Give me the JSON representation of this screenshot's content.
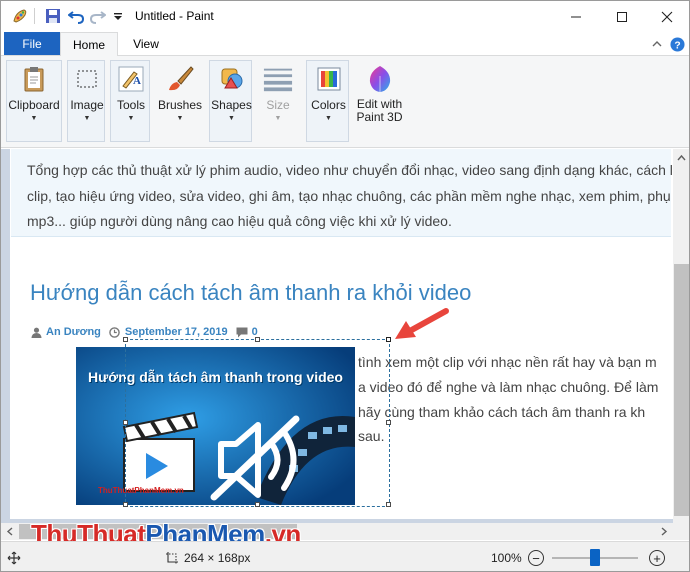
{
  "window": {
    "title": "Untitled - Paint"
  },
  "quick_access": [
    "paint-app-icon",
    "save-icon",
    "undo-icon",
    "redo-icon",
    "customize-dropdown-icon"
  ],
  "window_controls": [
    "minimize-icon",
    "maximize-icon",
    "close-icon"
  ],
  "tabs": [
    {
      "label": "File",
      "active": false
    },
    {
      "label": "Home",
      "active": true
    },
    {
      "label": "View",
      "active": false
    }
  ],
  "ribbon": {
    "clipboard": "Clipboard",
    "image": "Image",
    "tools": "Tools",
    "brushes": "Brushes",
    "shapes": "Shapes",
    "size": "Size",
    "colors": "Colors",
    "edit_paint3d_line1": "Edit with",
    "edit_paint3d_line2": "Paint 3D"
  },
  "canvas": {
    "intro_lines": [
      "Tổng hợp các thủ thuật xử lý phim audio, video như chuyển đổi nhạc, video sang định dạng khác, cách l",
      "clip, tạo hiệu ứng video, sửa video, ghi âm, tạo nhạc chuông, các phần mềm nghe nhạc, xem phim, phụ",
      "mp3... giúp người dùng nâng cao hiệu quả công việc khi xử lý video."
    ],
    "article_title": "Hướng dẫn cách tách âm thanh ra khỏi video",
    "meta": {
      "author": "An Dương",
      "date": "September 17, 2019",
      "comments": "0"
    },
    "thumbnail": {
      "title": "Hướng dẫn tách âm thanh trong video",
      "site": "ThuThuatPhanMem.vn"
    },
    "body_lines": [
      "tình xem một clip với nhạc nền rất hay và bạn m",
      "a video đó để nghe và làm nhạc chuông. Để làm",
      "hãy cùng tham khảo cách tách âm thanh ra kh",
      "sau."
    ]
  },
  "watermark": {
    "part1": "ThuThuat",
    "part2": "PhanMem",
    "part3": ".vn"
  },
  "statusbar": {
    "selection_size": "264 × 168px",
    "zoom": "100%",
    "zoom_level_fraction": 0.5
  },
  "colors": {
    "accent": "#1d64c0",
    "link": "#3a84c0",
    "arrow": "#e8453c",
    "zoom_thumb": "#0a63c4"
  }
}
